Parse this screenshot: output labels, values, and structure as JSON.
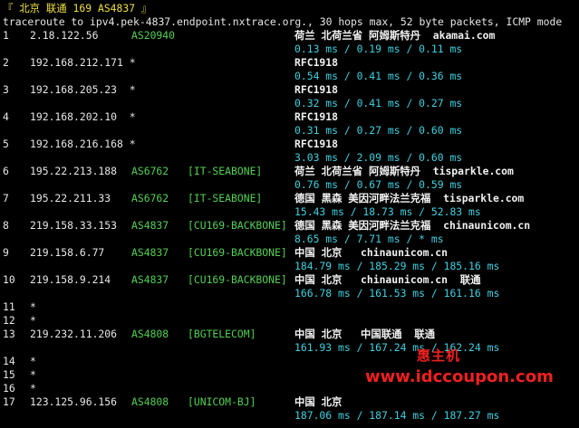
{
  "header": {
    "title_line": "『 北京 联通 169 AS4837 』",
    "command_line": "traceroute to ipv4.pek-4837.endpoint.nxtrace.org., 30 hops max, 52 byte packets, ICMP mode"
  },
  "hops": [
    {
      "hop": "1",
      "ip": "2.18.122.56",
      "asn": "AS20940",
      "tag": "",
      "geo": "荷兰 北荷兰省 阿姆斯特丹  akamai.com",
      "rtt": "0.13 ms / 0.19 ms / 0.11 ms"
    },
    {
      "hop": "2",
      "ip": "192.168.212.171 *",
      "asn": "",
      "tag": "",
      "geo": "RFC1918",
      "rtt": "0.54 ms / 0.41 ms / 0.36 ms"
    },
    {
      "hop": "3",
      "ip": "192.168.205.23  *",
      "asn": "",
      "tag": "",
      "geo": "RFC1918",
      "rtt": "0.32 ms / 0.41 ms / 0.27 ms"
    },
    {
      "hop": "4",
      "ip": "192.168.202.10  *",
      "asn": "",
      "tag": "",
      "geo": "RFC1918",
      "rtt": "0.31 ms / 0.27 ms / 0.60 ms"
    },
    {
      "hop": "5",
      "ip": "192.168.216.168 *",
      "asn": "",
      "tag": "",
      "geo": "RFC1918",
      "rtt": "3.03 ms / 2.09 ms / 0.60 ms"
    },
    {
      "hop": "6",
      "ip": "195.22.213.188",
      "asn": "AS6762",
      "tag": "[IT-SEABONE]",
      "geo": "荷兰 北荷兰省 阿姆斯特丹  tisparkle.com",
      "rtt": "0.76 ms / 0.67 ms / 0.59 ms"
    },
    {
      "hop": "7",
      "ip": "195.22.211.33",
      "asn": "AS6762",
      "tag": "[IT-SEABONE]",
      "geo": "德国 黑森 美因河畔法兰克福  tisparkle.com",
      "rtt": "15.43 ms / 18.73 ms / 52.83 ms"
    },
    {
      "hop": "8",
      "ip": "219.158.33.153",
      "asn": "AS4837",
      "tag": "[CU169-BACKBONE]",
      "geo": "德国 黑森 美因河畔法兰克福  chinaunicom.cn",
      "rtt": "8.65 ms / 7.71 ms / * ms"
    },
    {
      "hop": "9",
      "ip": "219.158.6.77",
      "asn": "AS4837",
      "tag": "[CU169-BACKBONE]",
      "geo": "中国 北京   chinaunicom.cn",
      "rtt": "184.79 ms / 185.29 ms / 185.16 ms"
    },
    {
      "hop": "10",
      "ip": "219.158.9.214",
      "asn": "AS4837",
      "tag": "[CU169-BACKBONE]",
      "geo": "中国 北京   chinaunicom.cn  联通",
      "rtt": "166.78 ms / 161.53 ms / 161.16 ms"
    },
    {
      "hop": "11",
      "ip": "*"
    },
    {
      "hop": "12",
      "ip": "*"
    },
    {
      "hop": "13",
      "ip": "219.232.11.206",
      "asn": "AS4808",
      "tag": "[BGTELECOM]",
      "geo": "中国 北京   中国联通  联通",
      "rtt": "161.93 ms / 167.24 ms / 162.24 ms"
    },
    {
      "hop": "14",
      "ip": "*"
    },
    {
      "hop": "15",
      "ip": "*"
    },
    {
      "hop": "16",
      "ip": "*"
    },
    {
      "hop": "17",
      "ip": "123.125.96.156",
      "asn": "AS4808",
      "tag": "[UNICOM-BJ]",
      "geo": "中国 北京",
      "rtt": "187.06 ms / 187.14 ms / 187.27 ms"
    }
  ],
  "watermark": {
    "name": "惠主机",
    "url": "www.idccoupon.com"
  },
  "colors": {
    "background": "#000000",
    "asn_green": "#52d052",
    "rtt_cyan": "#3fd0e0",
    "title_yellow": "#f0e040",
    "watermark_red": "#f02020"
  }
}
